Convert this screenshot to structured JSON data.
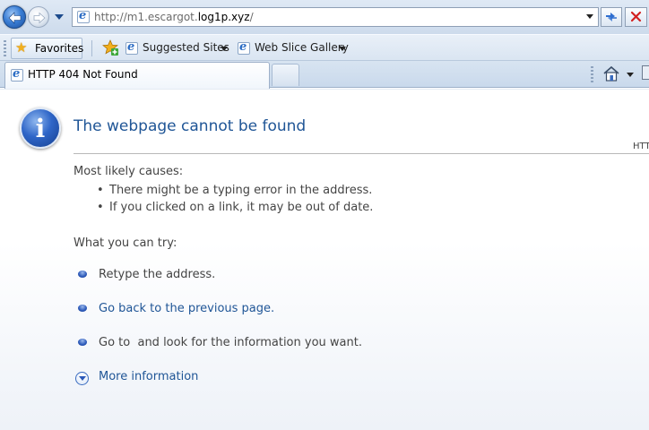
{
  "browser": {
    "address": {
      "prefix": "http://m1.escargot.",
      "domain": "log1p.xyz",
      "suffix": "/"
    },
    "favorites_bar": {
      "favorites_label": "Favorites",
      "links": [
        {
          "label": "Suggested Sites"
        },
        {
          "label": "Web Slice Gallery"
        }
      ]
    },
    "tab": {
      "title": "HTTP 404 Not Found"
    }
  },
  "page": {
    "title": "The webpage cannot be found",
    "corner_text": "HTT",
    "causes_heading": "Most likely causes:",
    "causes": [
      "There might be a typing error in the address.",
      "If you clicked on a link, it may be out of date."
    ],
    "try_heading": "What you can try:",
    "try_items": [
      {
        "text": "Retype the address.",
        "is_link": false
      },
      {
        "text": "Go back to the previous page.",
        "is_link": true
      },
      {
        "text": "Go to  and look for the information you want.",
        "is_link": false
      }
    ],
    "more_info": "More information"
  },
  "colors": {
    "link_blue": "#1f5596",
    "body_text": "#444444",
    "chrome_blue": "#cddbec"
  },
  "icons": [
    "back-arrow-icon",
    "forward-arrow-icon",
    "ie-page-icon",
    "refresh-icon",
    "close-icon",
    "star-icon",
    "add-favorites-icon",
    "home-icon",
    "print-icon",
    "info-icon",
    "expand-chevron-icon"
  ]
}
